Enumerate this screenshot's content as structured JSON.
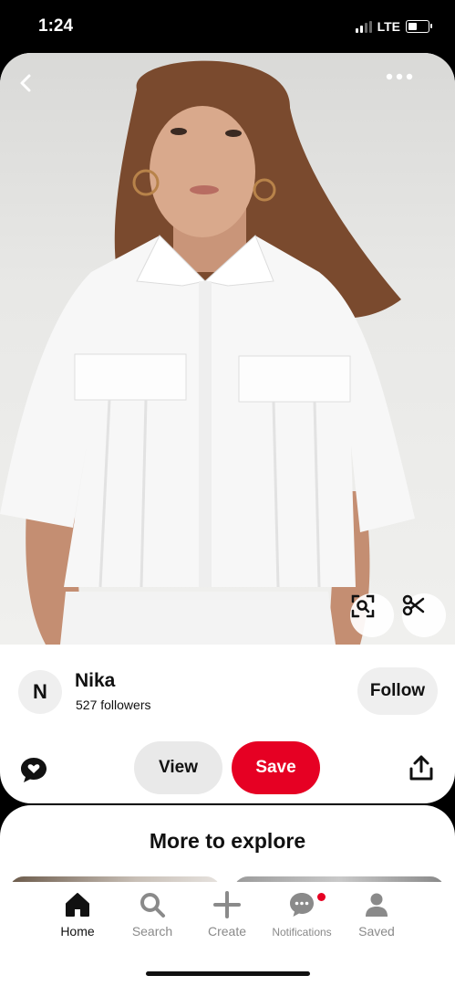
{
  "status_bar": {
    "time": "1:24",
    "network": "LTE",
    "signal_bars": 4,
    "signal_bars_active": 2,
    "battery_level": 0.45
  },
  "pin": {
    "icons": {
      "back": "chevron-left-icon",
      "more": "more-dots-icon",
      "visual_search": "lens-search-icon",
      "cutout": "scissors-icon"
    }
  },
  "creator": {
    "avatar_letter": "N",
    "name": "Nika",
    "followers": "527 followers",
    "follow_label": "Follow"
  },
  "actions": {
    "comment_icon": "speech-bubble-heart-icon",
    "view_label": "View",
    "save_label": "Save",
    "share_icon": "share-icon",
    "save_color": "#e60023"
  },
  "explore": {
    "title": "More to explore"
  },
  "nav": {
    "items": [
      {
        "label": "Home",
        "icon": "home-icon",
        "active": true
      },
      {
        "label": "Search",
        "icon": "search-icon",
        "active": false
      },
      {
        "label": "Create",
        "icon": "plus-icon",
        "active": false
      },
      {
        "label": "Notifications",
        "icon": "chat-bubble-icon",
        "active": false,
        "badge": true
      },
      {
        "label": "Saved",
        "icon": "profile-icon",
        "active": false
      }
    ]
  }
}
